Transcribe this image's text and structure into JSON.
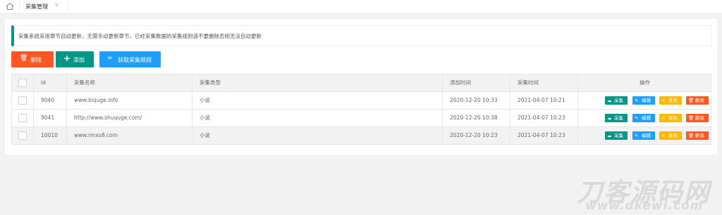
{
  "tabs": [
    {
      "label": "采集管理",
      "close": "✕"
    }
  ],
  "notice": "采集系统采用章节自动更新，无需手动更新章节，已经采集数据的采集规则请不要删除否则无法自动更新",
  "toolbar": {
    "delete_label": "删除",
    "add_label": "添加",
    "fetch_label": "获取采集规则"
  },
  "table": {
    "headers": [
      "id",
      "采集名称",
      "采集类型",
      "添加时间",
      "采集时间",
      "操作"
    ],
    "actions": {
      "collect": "采集",
      "edit": "编辑",
      "publish": "发布",
      "delete": "删除"
    },
    "rows": [
      {
        "id": "9040",
        "name": "www.biquge.info",
        "type": "小说",
        "added": "2020-12-20 10:33",
        "collected": "2021-04-07 10:21"
      },
      {
        "id": "9041",
        "name": "http://www.shuquge.com/",
        "type": "小说",
        "added": "2020-12-20 10:38",
        "collected": "2021-04-07 10:23"
      },
      {
        "id": "10010",
        "name": "www.rmxs8.com",
        "type": "小说",
        "added": "2020-12-20 10:23",
        "collected": "2021-04-07 10:23"
      }
    ]
  },
  "watermark": {
    "line1": "刀客源码网",
    "line2": "www.dkewl.com"
  },
  "colors": {
    "primary": "#009688",
    "normal": "#1e9fff",
    "warm": "#ffb800",
    "danger": "#ff5722"
  }
}
